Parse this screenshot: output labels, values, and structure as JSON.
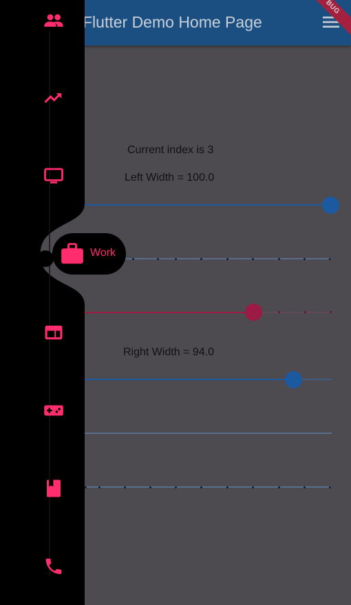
{
  "app_bar": {
    "title": "Flutter Demo Home Page",
    "menu_icon": "menu-icon",
    "debug_banner": "BUG",
    "background": "#1b4f82"
  },
  "content": {
    "current_index_text": "Current index is 3",
    "left_width_text": "Left Width = 100.0",
    "right_width_text": "Right Width = 94.0",
    "sliders": [
      {
        "name": "left-width-slider",
        "value": 1.0,
        "color": "#1b5aa0"
      },
      {
        "name": "stepped-slider-1",
        "divisions": 10,
        "color": "#596e8a"
      },
      {
        "name": "pink-slider",
        "value": 0.69,
        "color": "#9b1b45"
      },
      {
        "name": "right-width-slider",
        "value": 0.84,
        "color": "#1b5aa0"
      },
      {
        "name": "plain-line",
        "color": "#596e8a"
      },
      {
        "name": "stepped-slider-2",
        "divisions": 10,
        "color": "#596e8a"
      }
    ]
  },
  "sidebar": {
    "accent": "#ff2d6e",
    "items": [
      {
        "icon": "people-icon"
      },
      {
        "icon": "trending-up-icon"
      },
      {
        "icon": "monitor-icon"
      },
      {
        "icon": "briefcase-icon",
        "label": "Work",
        "selected": true
      },
      {
        "icon": "web-panel-icon"
      },
      {
        "icon": "gamepad-icon"
      },
      {
        "icon": "book-icon"
      },
      {
        "icon": "phone-icon"
      }
    ]
  }
}
